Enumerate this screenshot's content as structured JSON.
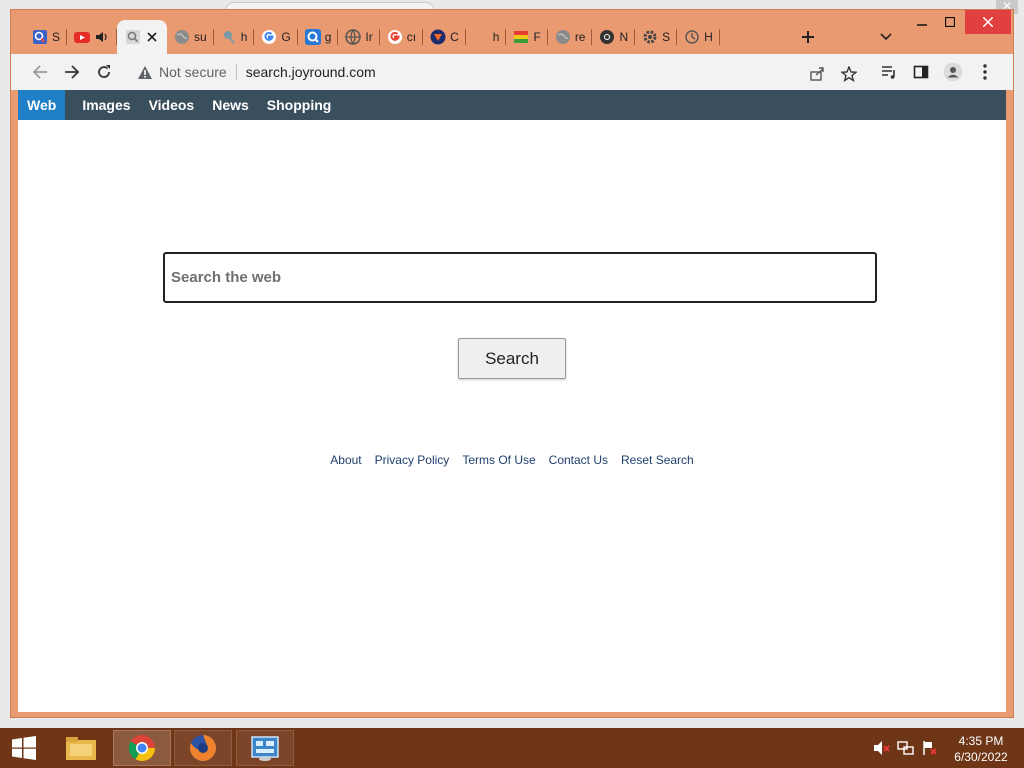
{
  "browser": {
    "tabs": [
      {
        "title": "S",
        "icon": "search-favicon-icon"
      },
      {
        "title": "",
        "icon": "youtube-icon",
        "audio": true
      },
      {
        "title": "",
        "icon": "search-favicon-icon",
        "active": true
      },
      {
        "title": "su",
        "icon": "globe-icon"
      },
      {
        "title": "h",
        "icon": "magnifier-icon"
      },
      {
        "title": "G",
        "icon": "google-icon"
      },
      {
        "title": "g",
        "icon": "q-search-icon"
      },
      {
        "title": "Ir",
        "icon": "globe-icon"
      },
      {
        "title": "cı",
        "icon": "google-icon"
      },
      {
        "title": "C",
        "icon": "shield-icon"
      },
      {
        "title": "h",
        "icon": "blank-icon"
      },
      {
        "title": "F",
        "icon": "flag-icon"
      },
      {
        "title": "re",
        "icon": "globe-icon"
      },
      {
        "title": "N",
        "icon": "chrome-icon"
      },
      {
        "title": "S",
        "icon": "gear-icon"
      },
      {
        "title": "H",
        "icon": "history-icon"
      }
    ],
    "omnibox": {
      "security_label": "Not secure",
      "url": "search.joyround.com"
    },
    "accent": "#ea9a70"
  },
  "page": {
    "nav": {
      "items": [
        "Web",
        "Images",
        "Videos",
        "News",
        "Shopping"
      ],
      "active": "Web",
      "bg": "#3a4f5e",
      "active_bg": "#1e7fc7"
    },
    "search": {
      "placeholder": "Search the web",
      "button_label": "Search"
    },
    "footer": {
      "links": [
        "About",
        "Privacy Policy",
        "Terms Of Use",
        "Contact Us",
        "Reset Search"
      ]
    }
  },
  "taskbar": {
    "time": "4:35 PM",
    "date": "6/30/2022",
    "apps": [
      "file-explorer-icon",
      "chrome-icon",
      "firefox-icon",
      "control-panel-icon"
    ]
  }
}
